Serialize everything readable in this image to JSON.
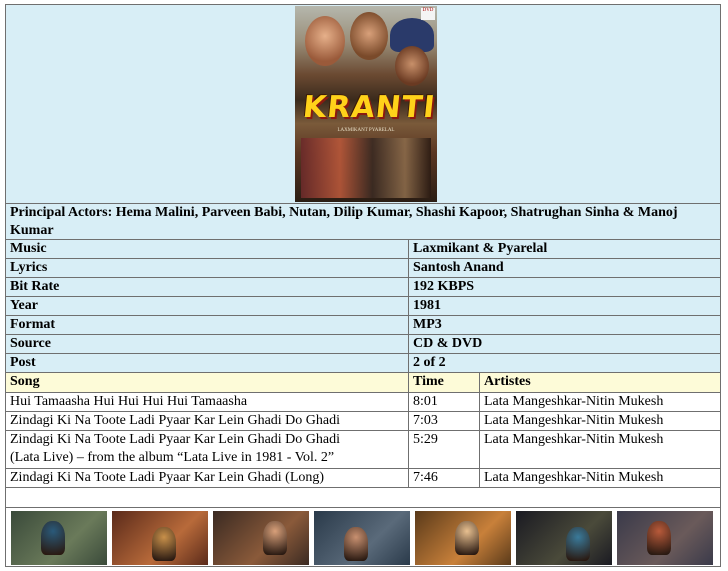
{
  "poster": {
    "title": "KRANTI",
    "credit": "LAXMIKANT PYARELAL",
    "badge": "DVD",
    "colors": {
      "title": "#ffd21a",
      "title_shadow": "#8a1a10"
    }
  },
  "principal_actors": "Principal Actors: Hema Malini, Parveen Babi, Nutan, Dilip Kumar, Shashi Kapoor, Shatrughan Sinha & Manoj Kumar",
  "info": [
    {
      "label": "Music",
      "value": "Laxmikant & Pyarelal"
    },
    {
      "label": "Lyrics",
      "value": "Santosh Anand"
    },
    {
      "label": "Bit Rate",
      "value": "192 KBPS"
    },
    {
      "label": "Year",
      "value": "1981"
    },
    {
      "label": "Format",
      "value": "MP3"
    },
    {
      "label": "Source",
      "value": "CD & DVD"
    },
    {
      "label": "Post",
      "value": "2 of 2"
    }
  ],
  "songs_header": {
    "song": "Song",
    "time": "Time",
    "artistes": "Artistes"
  },
  "songs": [
    {
      "song": "Hui Tamaasha  Hui Hui Hui Hui Tamaasha",
      "song2": "",
      "time": "8:01",
      "artistes": "Lata Mangeshkar-Nitin Mukesh"
    },
    {
      "song": "Zindagi Ki Na Toote Ladi Pyaar Kar Lein Ghadi Do Ghadi",
      "song2": "",
      "time": "7:03",
      "artistes": "Lata Mangeshkar-Nitin Mukesh"
    },
    {
      "song": "Zindagi Ki Na Toote Ladi Pyaar Kar Lein Ghadi Do Ghadi",
      "song2": "(Lata Live) – from the album “Lata Live in 1981 - Vol. 2”",
      "time": "5:29",
      "artistes": "Lata Mangeshkar-Nitin Mukesh"
    },
    {
      "song": "Zindagi Ki Na Toote Ladi Pyaar Kar Lein Ghadi (Long)",
      "song2": "",
      "time": "7:46",
      "artistes": "Lata Mangeshkar-Nitin Mukesh"
    }
  ],
  "colors": {
    "info_background": "#d8eef6",
    "header_background": "#fdfbd8",
    "border": "#6f6f6f"
  },
  "thumbnails": [
    {
      "name": "still-1",
      "bg": [
        "#3a4a3a",
        "#6a7a5a"
      ],
      "fig": "#2a5a7a"
    },
    {
      "name": "still-2",
      "bg": [
        "#5a2a1a",
        "#b86a3a"
      ],
      "fig": "#c8904a"
    },
    {
      "name": "still-3",
      "bg": [
        "#3a2a22",
        "#8a5a3a"
      ],
      "fig": "#d8a07a"
    },
    {
      "name": "still-4",
      "bg": [
        "#2a3a4a",
        "#5a6a7a"
      ],
      "fig": "#c89070"
    },
    {
      "name": "still-5",
      "bg": [
        "#5a3a1a",
        "#c8803a"
      ],
      "fig": "#e8c090"
    },
    {
      "name": "still-6",
      "bg": [
        "#1a1a22",
        "#4a4a3a"
      ],
      "fig": "#3a7a9a"
    },
    {
      "name": "still-7",
      "bg": [
        "#3a3a4a",
        "#6a5a5a"
      ],
      "fig": "#b85a3a"
    }
  ]
}
